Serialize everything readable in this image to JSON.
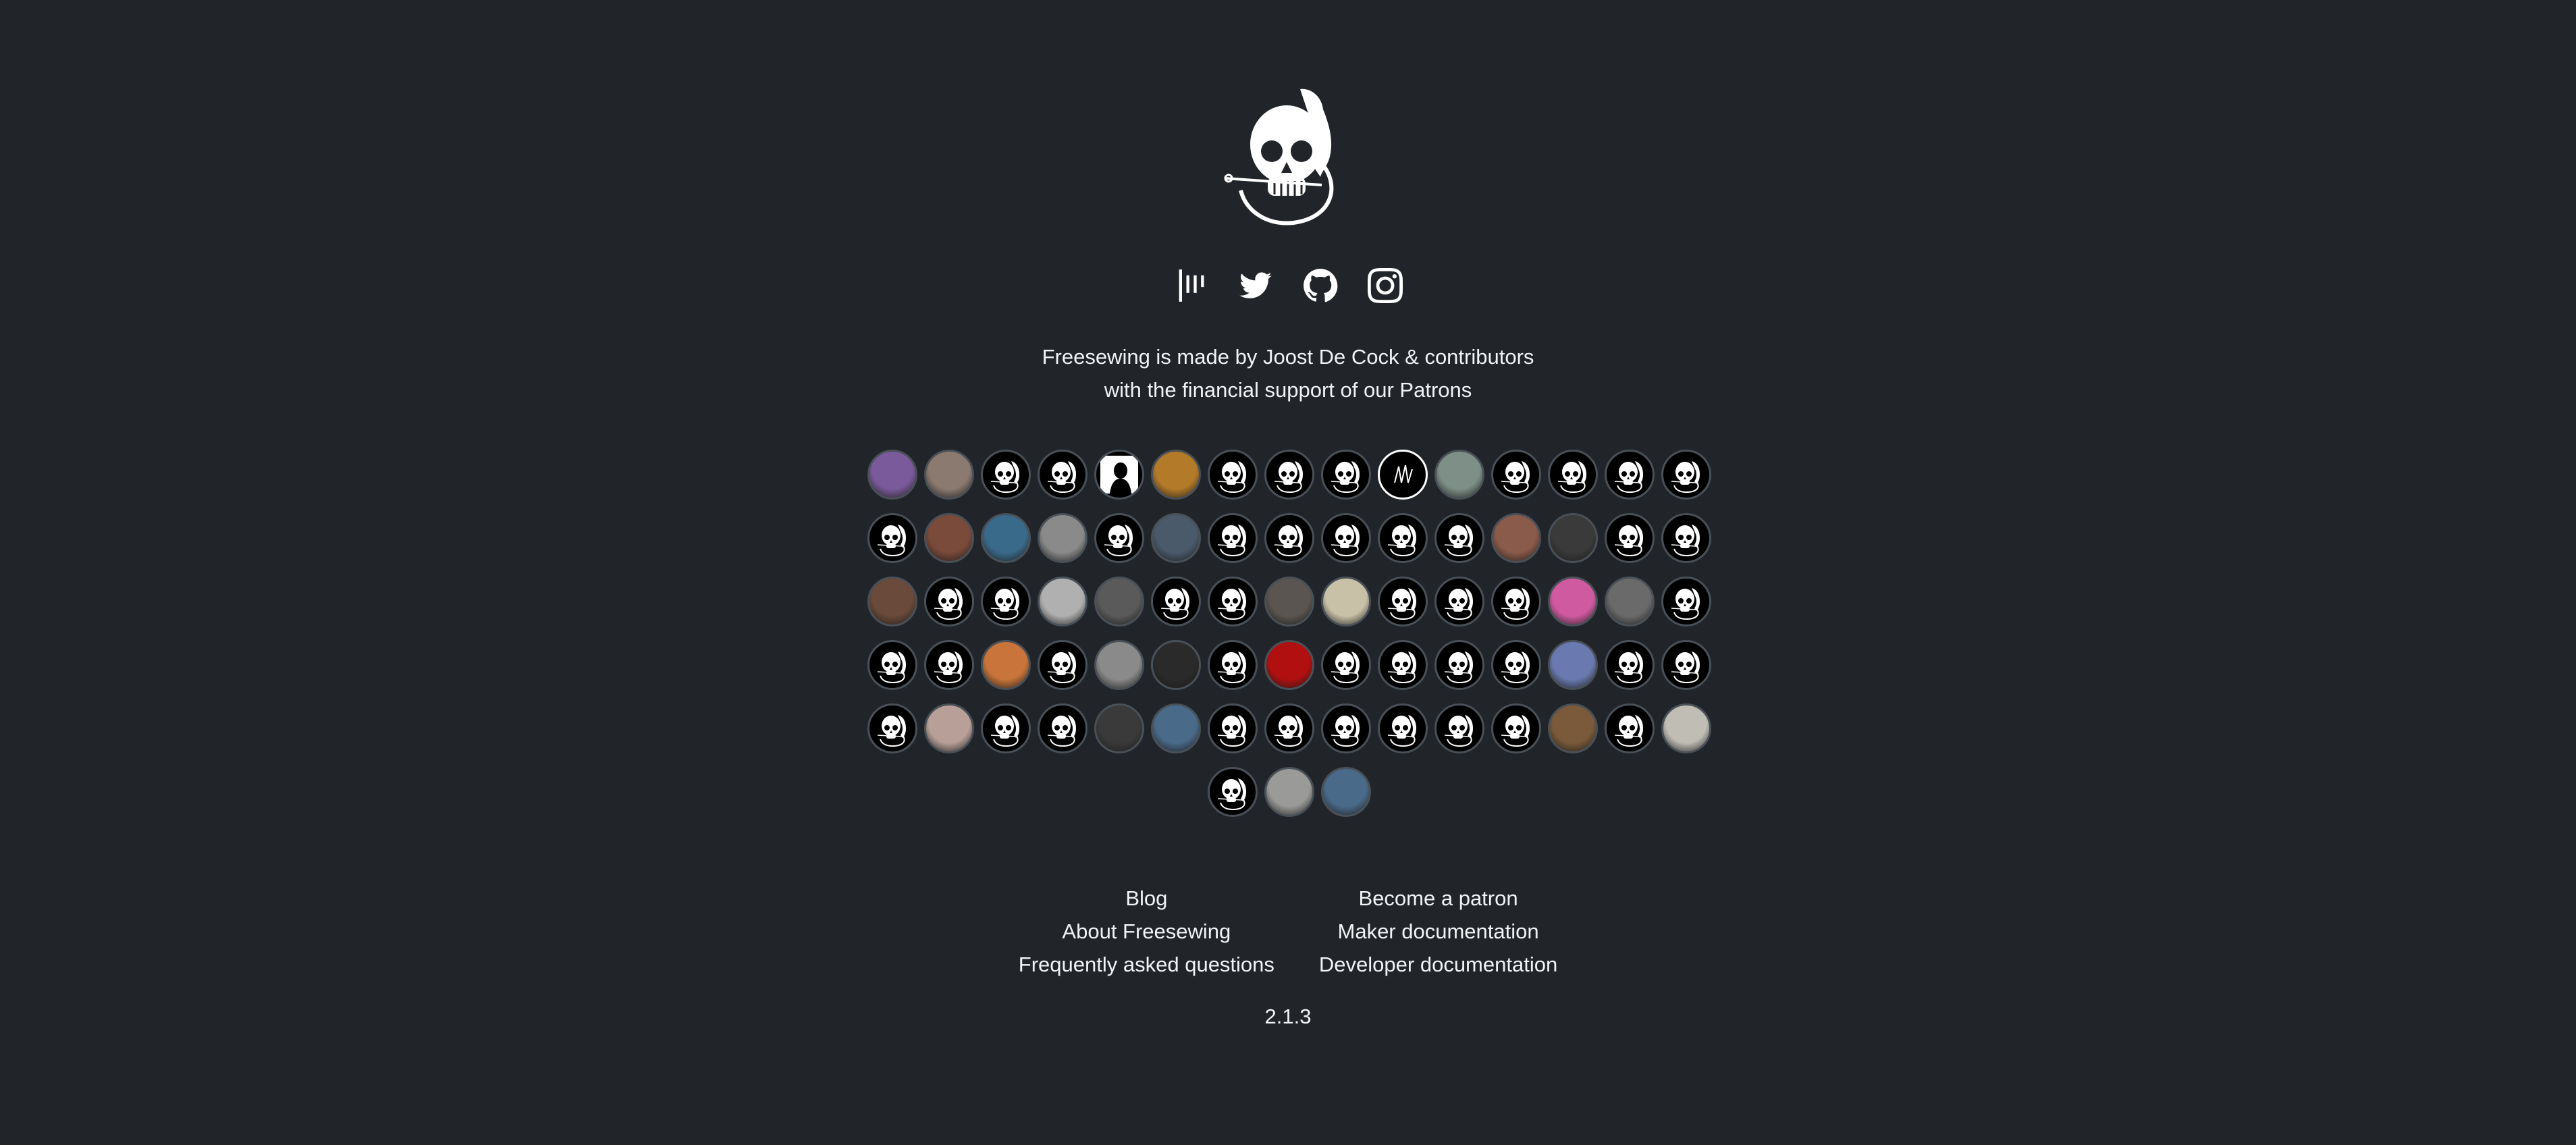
{
  "logo": {
    "icon": "freesewing-skull-logo"
  },
  "social": [
    {
      "name": "gitter",
      "icon": "gitter-icon"
    },
    {
      "name": "twitter",
      "icon": "twitter-icon"
    },
    {
      "name": "github",
      "icon": "github-icon"
    },
    {
      "name": "instagram",
      "icon": "instagram-icon"
    }
  ],
  "credits": {
    "line1_prefix": "Freesewing is made by ",
    "author": "Joost De Cock",
    "line1_mid": " & ",
    "contributors": "contributors",
    "line2_prefix": "with the financial support of our ",
    "patrons": "Patrons"
  },
  "patron_avatars": [
    "#7a5a9a",
    "#8a7a70",
    "skull",
    "skull",
    "silhouette",
    "#b37a2a",
    "skull",
    "skull",
    "skull",
    "scribble",
    "#7d8f86",
    "skull",
    "skull",
    "skull",
    "skull",
    "skull",
    "#7a4a3a",
    "#3a6a8a",
    "#8a8a8a",
    "skull",
    "#4a5a6a",
    "skull",
    "skull",
    "skull",
    "skull",
    "skull",
    "#8a5a4a",
    "#3a3a3a",
    "skull",
    "skull",
    "#6a4a3a",
    "skull",
    "skull",
    "#b0b0b0",
    "#5a5a5a",
    "skull",
    "skull",
    "#5a5550",
    "#c9c0a8",
    "skull",
    "skull",
    "skull",
    "#d05aa0",
    "#6a6a6a",
    "skull",
    "skull",
    "skull",
    "#c8743a",
    "skull",
    "#8a8a8a",
    "#2a2a2a",
    "skull",
    "#b01010",
    "skull",
    "skull",
    "skull",
    "skull",
    "#6a7ab0",
    "skull",
    "skull",
    "skull",
    "#b8a098",
    "skull",
    "skull",
    "#3a3a3a",
    "#4a6a8a",
    "skull",
    "skull",
    "skull",
    "skull",
    "skull",
    "skull",
    "#7a5a3a",
    "skull",
    "#c0bdb5",
    "skull",
    "#9a9a98",
    "#4a6a8a"
  ],
  "links": {
    "left": [
      "Blog",
      "About Freesewing",
      "Frequently asked questions"
    ],
    "right": [
      "Become a patron",
      "Maker documentation",
      "Developer documentation"
    ]
  },
  "version": "2.1.3"
}
